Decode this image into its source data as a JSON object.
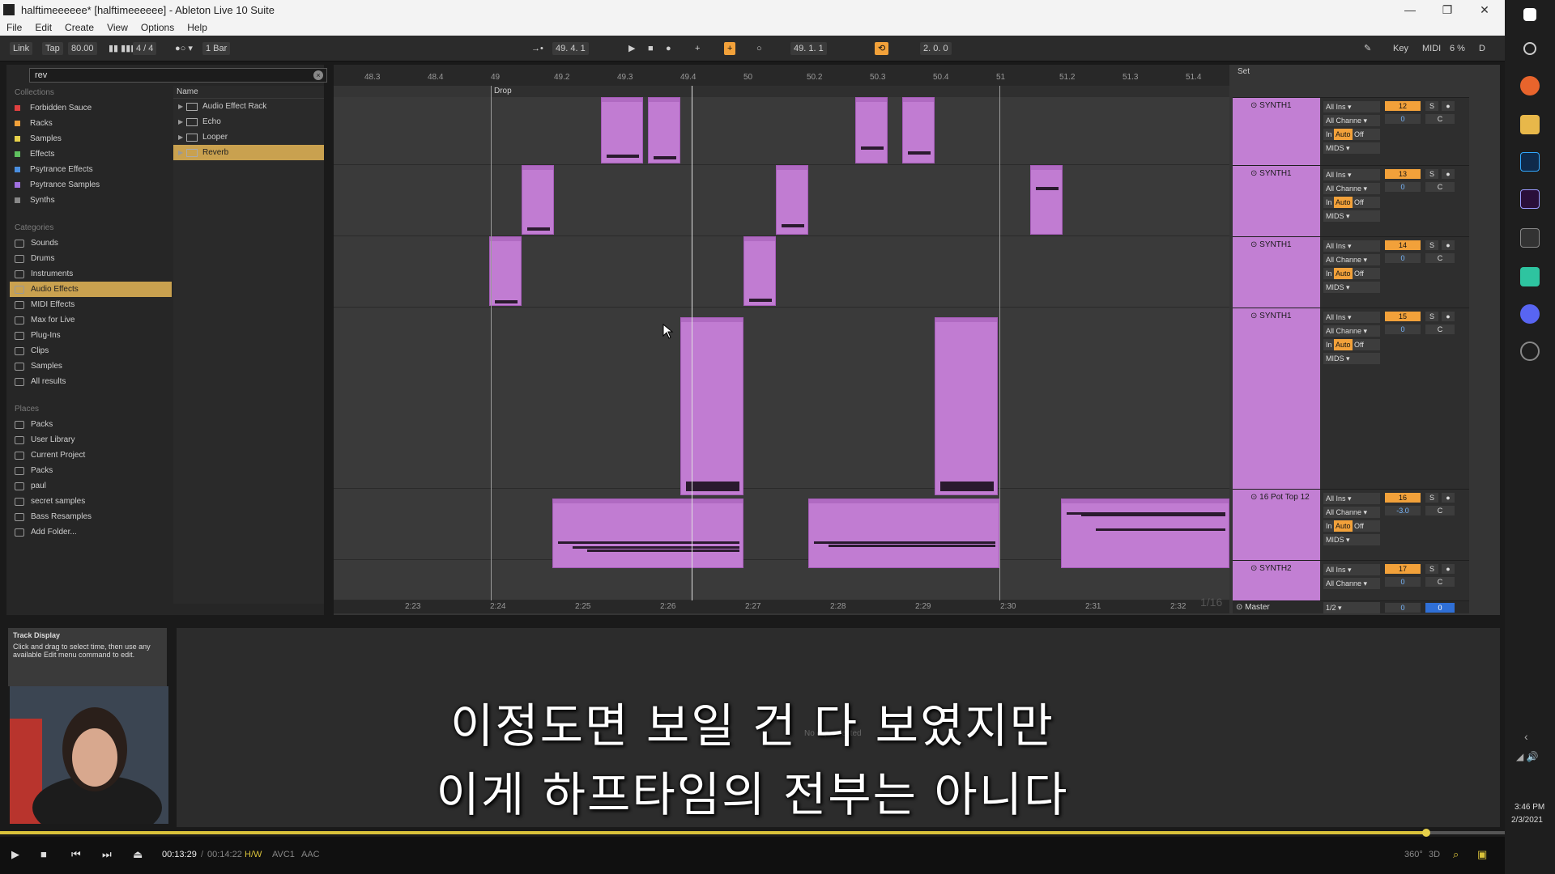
{
  "window": {
    "title": "halftimeeeeee*  [halftimeeeeee] - Ableton Live 10 Suite",
    "minimize": "—",
    "restore": "❐",
    "close": "✕"
  },
  "menu": [
    "File",
    "Edit",
    "Create",
    "View",
    "Options",
    "Help"
  ],
  "control_bar": {
    "link": "Link",
    "tap": "Tap",
    "tempo": "80.00",
    "time_sig": "4 / 4",
    "quantize": "1 Bar",
    "position": "49.   4.   1",
    "loop_start": "49.   1.   1",
    "loop_length": "2.   0.   0",
    "key": "Key",
    "midi": "MIDI",
    "cpu": "6 %",
    "d": "D"
  },
  "browser": {
    "search_value": "rev",
    "collections_title": "Collections",
    "collections": [
      {
        "label": "Forbidden Sauce",
        "color": "#e04040"
      },
      {
        "label": "Racks",
        "color": "#f2a13a"
      },
      {
        "label": "Samples",
        "color": "#e8d24a"
      },
      {
        "label": "Effects",
        "color": "#5fc15f"
      },
      {
        "label": "Psytrance Effects",
        "color": "#4a8fe0"
      },
      {
        "label": "Psytrance Samples",
        "color": "#a070e0"
      },
      {
        "label": "Synths",
        "color": "#888888"
      }
    ],
    "categories_title": "Categories",
    "categories": [
      "Sounds",
      "Drums",
      "Instruments",
      "Audio Effects",
      "MIDI Effects",
      "Max for Live",
      "Plug-Ins",
      "Clips",
      "Samples",
      "All results"
    ],
    "active_category": "Audio Effects",
    "places_title": "Places",
    "places": [
      "Packs",
      "User Library",
      "Current Project",
      "Packs",
      "paul",
      "secret samples",
      "Bass Resamples",
      "Add Folder..."
    ],
    "name_header": "Name",
    "results": [
      "Audio Effect Rack",
      "Echo",
      "Looper",
      "Reverb"
    ],
    "active_result": "Reverb"
  },
  "arrangement": {
    "ruler": [
      "48.3",
      "48.4",
      "49",
      "49.2",
      "49.3",
      "49.4",
      "50",
      "50.2",
      "50.3",
      "50.4",
      "51",
      "51.2",
      "51.3",
      "51.4"
    ],
    "locator_label": "Drop",
    "time_ticks": [
      "2:23",
      "2:24",
      "2:25",
      "2:26",
      "2:27",
      "2:28",
      "2:29",
      "2:30",
      "2:31",
      "2:32"
    ],
    "zoom_label": "1/16",
    "set_label": "Set"
  },
  "tracks": [
    {
      "name": "SYNTH1",
      "input": "All Ins",
      "channel": "All Channe",
      "monitor_in": "In",
      "monitor_auto": "Auto",
      "monitor_off": "Off",
      "output": "MIDS",
      "number": "12",
      "volume": "0",
      "pan": "C"
    },
    {
      "name": "SYNTH1",
      "input": "All Ins",
      "channel": "All Channe",
      "monitor_in": "In",
      "monitor_auto": "Auto",
      "monitor_off": "Off",
      "output": "MIDS",
      "number": "13",
      "volume": "0",
      "pan": "C"
    },
    {
      "name": "SYNTH1",
      "input": "All Ins",
      "channel": "All Channe",
      "monitor_in": "In",
      "monitor_auto": "Auto",
      "monitor_off": "Off",
      "output": "MIDS",
      "number": "14",
      "volume": "0",
      "pan": "C"
    },
    {
      "name": "SYNTH1",
      "input": "All Ins",
      "channel": "All Channe",
      "monitor_in": "In",
      "monitor_auto": "Auto",
      "monitor_off": "Off",
      "output": "MIDS",
      "number": "15",
      "volume": "0",
      "pan": "C"
    },
    {
      "name": "16 Pot Top 12",
      "input": "All Ins",
      "channel": "All Channe",
      "monitor_in": "In",
      "monitor_auto": "Auto",
      "monitor_off": "Off",
      "output": "MIDS",
      "number": "16",
      "volume": "-3.0",
      "pan": "C"
    },
    {
      "name": "SYNTH2",
      "input": "All Ins",
      "channel": "All Channe",
      "monitor_in": "",
      "monitor_auto": "",
      "monitor_off": "",
      "output": "",
      "number": "17",
      "volume": "0",
      "pan": "C"
    }
  ],
  "master": {
    "name": "Master",
    "output": "1/2",
    "volume": "0",
    "pan": "0"
  },
  "info_view": {
    "title": "Track Display",
    "body": "Click and drag to select time, then use any available Edit menu command to edit."
  },
  "detail_placeholder": "No clip selected",
  "subtitles": [
    "이정도면 보일 건 다 보였지만",
    "이게 하프타임의 전부는 아니다"
  ],
  "player": {
    "current": "00:13:29",
    "total": "00:14:22",
    "hw": "H/W",
    "codec_video": "AVC1",
    "codec_audio": "AAC",
    "progress": 0.948,
    "deg": "360°",
    "three_d": "3D"
  },
  "clock": {
    "time": "3:46 PM",
    "date": "2/3/2021"
  },
  "colors": {
    "clip": "#c17cd2",
    "accent": "#f2a13a",
    "selection": "#c9a14f"
  }
}
